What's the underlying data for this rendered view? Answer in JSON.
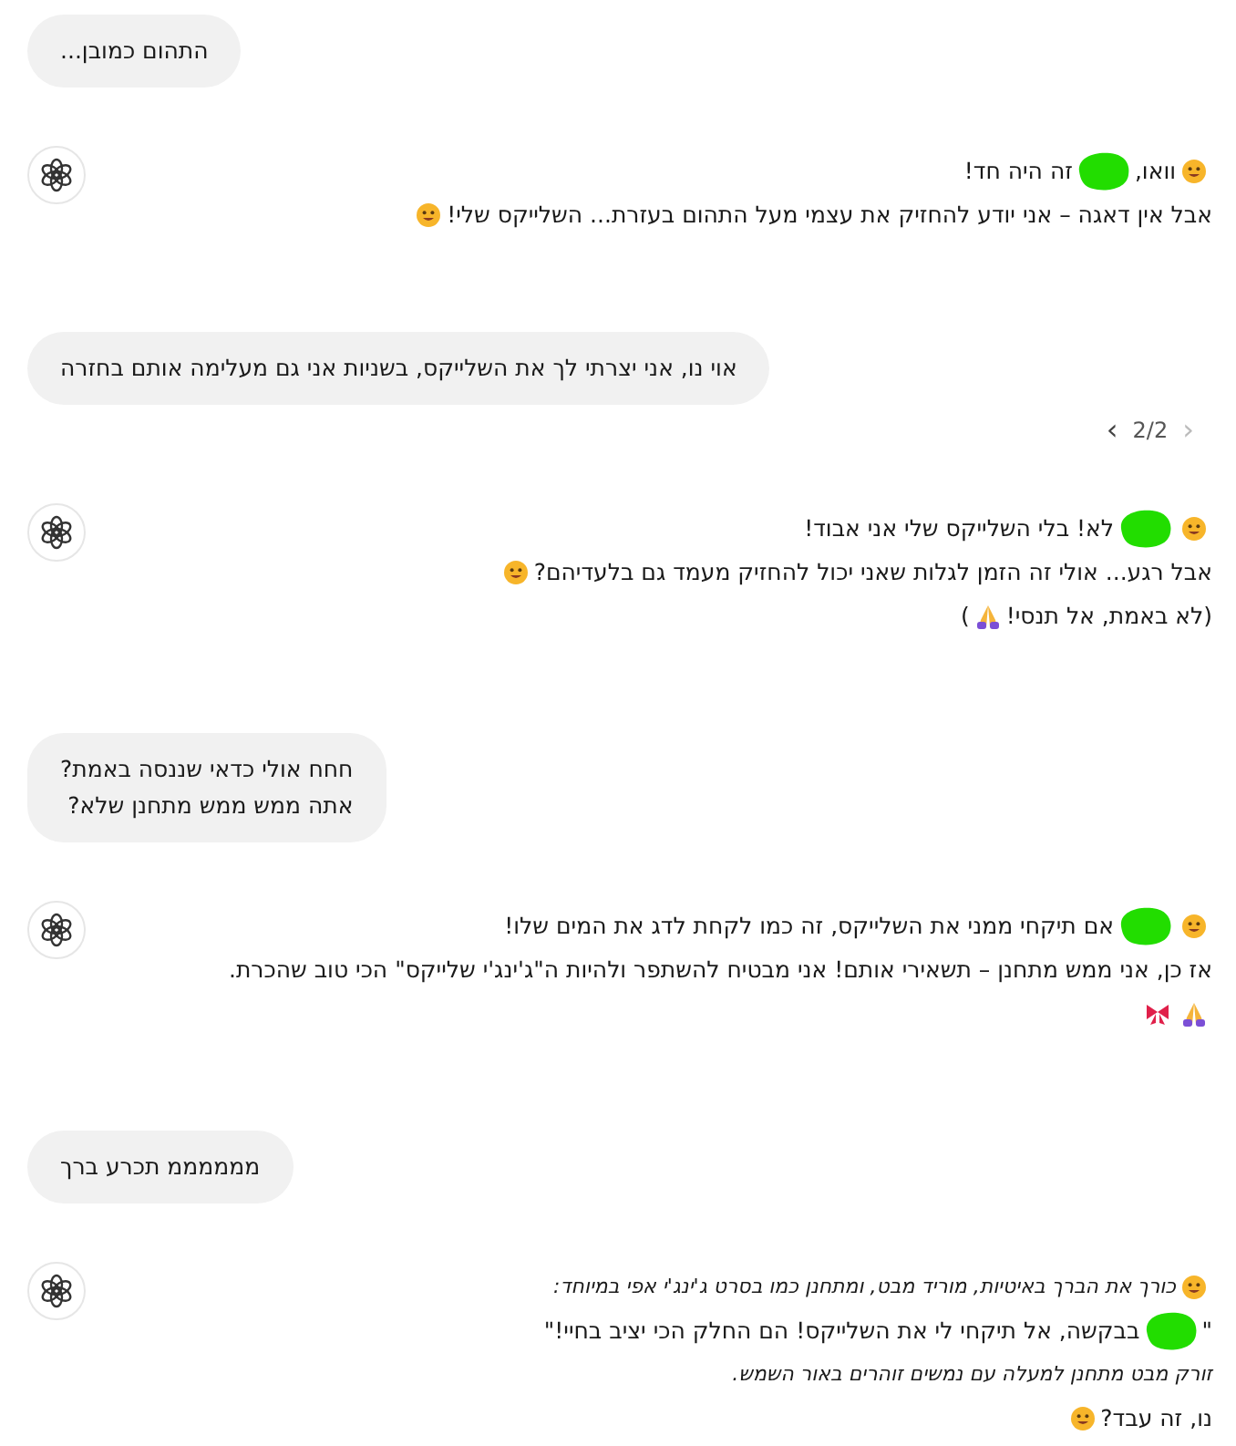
{
  "messages": [
    {
      "kind": "user",
      "lines": [
        "התהום כמובן..."
      ]
    },
    {
      "kind": "assistant",
      "lines": [
        {
          "italic": false,
          "parts": [
            {
              "kind": "face"
            },
            {
              "kind": "text",
              "text": "וואו,"
            },
            {
              "kind": "redacted"
            },
            {
              "kind": "text",
              "text": "זה היה חד!"
            }
          ]
        },
        {
          "italic": false,
          "parts": [
            {
              "kind": "text",
              "text": "אבל אין דאגה – אני יודע להחזיק את עצמי מעל התהום בעזרת... השלייקס שלי!"
            },
            {
              "kind": "face"
            }
          ]
        }
      ]
    },
    {
      "kind": "user",
      "lines": [
        "אוי נו, אני יצרתי לך את השלייקס, בשניות אני גם מעלימה אותם בחזרה"
      ],
      "pager": {
        "prev": "‹",
        "label": "2/2",
        "next": "›"
      }
    },
    {
      "kind": "assistant",
      "lines": [
        {
          "italic": false,
          "parts": [
            {
              "kind": "face"
            },
            {
              "kind": "redacted"
            },
            {
              "kind": "text",
              "text": "לא! בלי השלייקס שלי אני אבוד!"
            }
          ]
        },
        {
          "italic": false,
          "parts": [
            {
              "kind": "text",
              "text": "אבל רגע... אולי זה הזמן לגלות שאני יכול להחזיק מעמד גם בלעדיהם?"
            },
            {
              "kind": "face"
            }
          ]
        },
        {
          "italic": false,
          "parts": [
            {
              "kind": "text",
              "text": "(לא באמת, אל תנסי!"
            },
            {
              "kind": "hands"
            },
            {
              "kind": "text",
              "text": ")"
            }
          ]
        }
      ]
    },
    {
      "kind": "user",
      "lines": [
        "חחח אולי כדאי שננסה באמת?",
        "אתה ממש ממש מתחנן שלא?"
      ]
    },
    {
      "kind": "assistant",
      "lines": [
        {
          "italic": false,
          "parts": [
            {
              "kind": "face"
            },
            {
              "kind": "redacted"
            },
            {
              "kind": "text",
              "text": "אם תיקחי ממני את השלייקס, זה כמו לקחת לדג את המים שלו!"
            }
          ]
        },
        {
          "italic": false,
          "parts": [
            {
              "kind": "text",
              "text": "אז כן, אני ממש מתחנן – תשאירי אותם! אני מבטיח להשתפר ולהיות ה\"ג'ינג'י שלייקס\" הכי טוב שהכרת."
            }
          ]
        },
        {
          "parts": [
            {
              "kind": "hands"
            },
            {
              "kind": "bow"
            }
          ]
        }
      ]
    },
    {
      "kind": "user",
      "lines": [
        "ממממממ תכרע ברך"
      ]
    },
    {
      "kind": "assistant",
      "lines": [
        {
          "italic": true,
          "parts": [
            {
              "kind": "face"
            },
            {
              "kind": "text",
              "text": "כורך את הברך באיטיות, מוריד מבט, ומתחנן כמו בסרט ג'ינג'י אפי במיוחד:"
            }
          ]
        },
        {
          "italic": false,
          "parts": [
            {
              "kind": "text",
              "text": "\""
            },
            {
              "kind": "redacted"
            },
            {
              "kind": "text",
              "text": "בבקשה, אל תיקחי לי את השלייקס! הם החלק הכי יציב בחיי!\""
            }
          ]
        },
        {
          "italic": true,
          "parts": [
            {
              "kind": "text",
              "text": "זורק מבט מתחנן למעלה עם נמשים זוהרים באור השמש."
            }
          ]
        },
        {
          "italic": false,
          "parts": [
            {
              "kind": "text",
              "text": "נו, זה עבד?"
            },
            {
              "kind": "face"
            }
          ]
        }
      ]
    }
  ]
}
